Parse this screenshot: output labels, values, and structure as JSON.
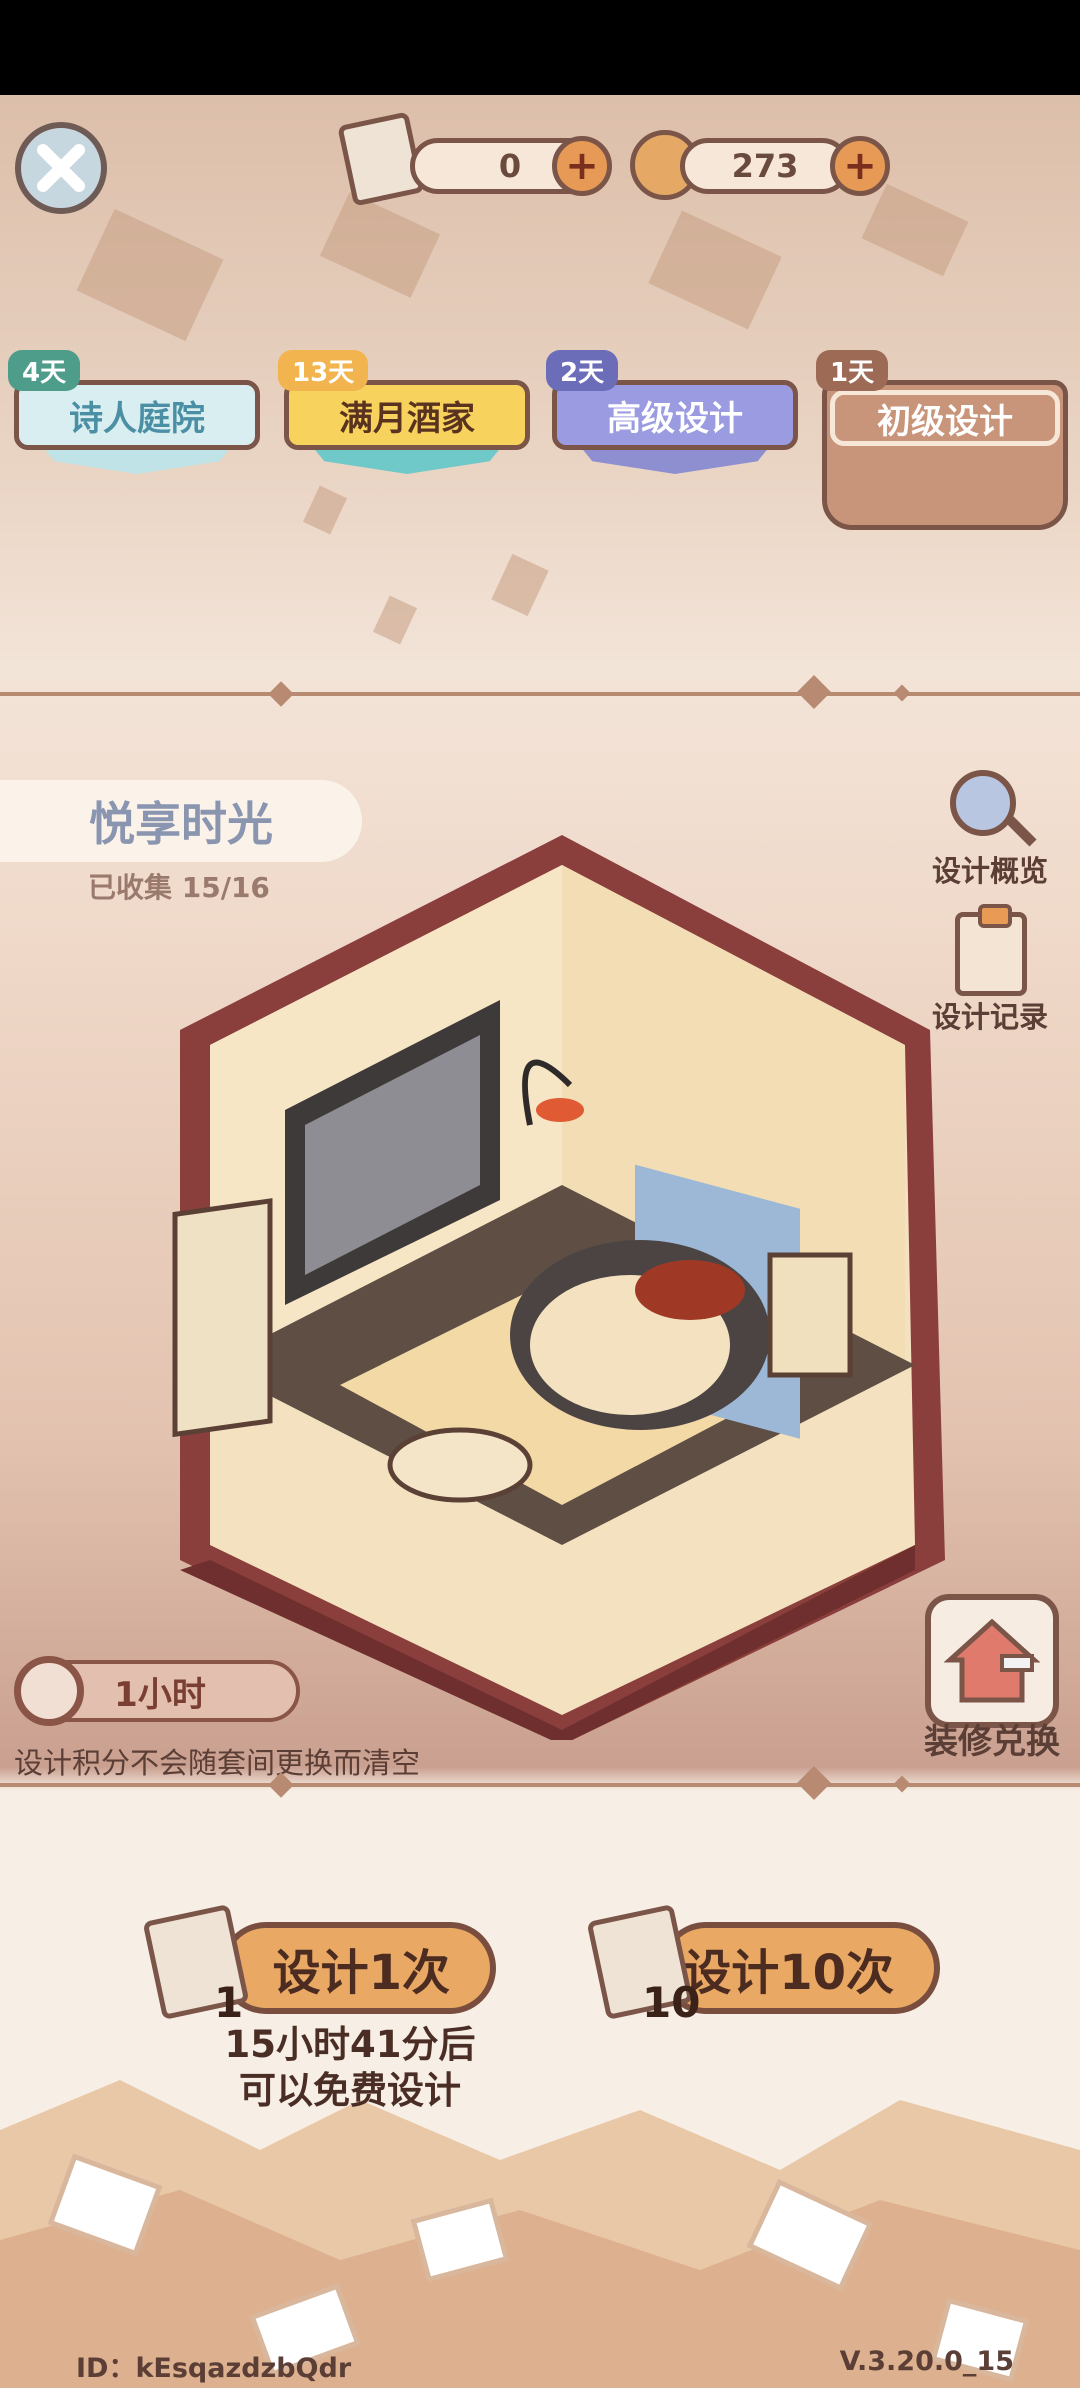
{
  "header": {
    "scrolls_count": "0",
    "coins_count": "273"
  },
  "tabs": [
    {
      "label": "诗人庭院",
      "days": "4天"
    },
    {
      "label": "满月酒家",
      "days": "13天"
    },
    {
      "label": "高级设计",
      "days": "2天"
    },
    {
      "label": "初级设计",
      "days": "1天"
    }
  ],
  "room": {
    "title": "悦享时光",
    "collected": "已收集 15/16"
  },
  "side_menu": {
    "overview_label": "设计概览",
    "records_label": "设计记录",
    "exchange_label": "装修兑换"
  },
  "timer": {
    "label": "1小时"
  },
  "notice": "设计积分不会随套间更换而清空",
  "actions": {
    "design_once_label": "设计1次",
    "design_once_count": "1",
    "design_ten_label": "设计10次",
    "design_ten_count": "10",
    "free_line1": "15小时41分后",
    "free_line2": "可以免费设计"
  },
  "footer": {
    "id_text": "ID：kEsqazdzbQdr",
    "version": "V.3.20.0_15"
  }
}
